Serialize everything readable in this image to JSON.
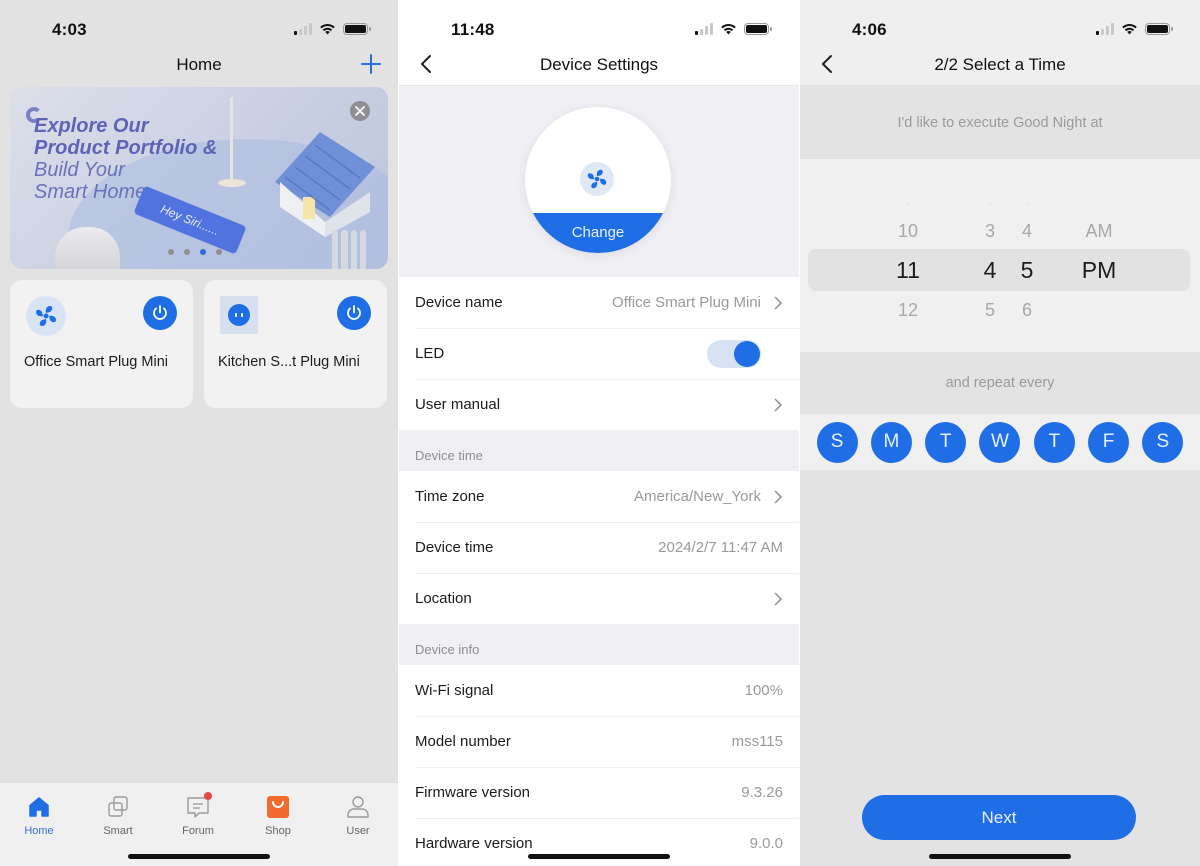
{
  "screens": {
    "home": {
      "status_time": "4:03",
      "title": "Home",
      "banner": {
        "headline_bold_1": "Explore Our",
        "headline_bold_2": "Product Portfolio &",
        "headline_light_1": "Build Your",
        "headline_light_2": "Smart Home",
        "tag_text": "Hey Siri......",
        "page_count": 4,
        "active_page": 3
      },
      "devices": [
        {
          "name": "Office Smart Plug Mini",
          "icon": "fan-icon",
          "power_on": true
        },
        {
          "name": "Kitchen S...t Plug Mini",
          "icon": "plug-icon",
          "power_on": true
        }
      ],
      "tabs": [
        {
          "label": "Home",
          "icon": "home-icon",
          "active": true
        },
        {
          "label": "Smart",
          "icon": "smart-icon",
          "active": false
        },
        {
          "label": "Forum",
          "icon": "forum-icon",
          "active": false,
          "badge": true
        },
        {
          "label": "Shop",
          "icon": "shop-bag-icon",
          "active": false
        },
        {
          "label": "User",
          "icon": "user-icon",
          "active": false
        }
      ]
    },
    "device_settings": {
      "status_time": "11:48",
      "title": "Device Settings",
      "change_label": "Change",
      "general": [
        {
          "label": "Device name",
          "value": "Office Smart Plug Mini",
          "chevron": true
        },
        {
          "label": "LED",
          "toggle": true
        },
        {
          "label": "User manual",
          "value": "",
          "chevron": true
        }
      ],
      "device_time_header": "Device time",
      "device_time": [
        {
          "label": "Time zone",
          "value": "America/New_York",
          "chevron": true
        },
        {
          "label": "Device time",
          "value": "2024/2/7 11:47 AM",
          "chevron": false
        },
        {
          "label": "Location",
          "value": "",
          "chevron": true
        }
      ],
      "device_info_header": "Device info",
      "device_info": [
        {
          "label": "Wi-Fi signal",
          "value": "100%"
        },
        {
          "label": "Model number",
          "value": "mss115"
        },
        {
          "label": "Firmware version",
          "value": "9.3.26"
        },
        {
          "label": "Hardware version",
          "value": "9.0.0"
        }
      ]
    },
    "select_time": {
      "status_time": "4:06",
      "title": "2/2 Select a Time",
      "prompt": "I'd like to execute Good Night at",
      "picker": {
        "hour": {
          "prev": "10",
          "selected": "11",
          "next": "12"
        },
        "minute_tens": {
          "prev": "3",
          "selected": "4",
          "next": "5"
        },
        "minute_ones": {
          "prev": "4",
          "selected": "5",
          "next": "6"
        },
        "period": {
          "prev": "AM",
          "selected": "PM"
        }
      },
      "repeat_label": "and repeat every",
      "days": [
        "S",
        "M",
        "T",
        "W",
        "T",
        "F",
        "S"
      ],
      "next_label": "Next"
    }
  },
  "colors": {
    "accent": "#1f6ee6",
    "shop": "#f26a2e",
    "badge": "#e64545"
  }
}
